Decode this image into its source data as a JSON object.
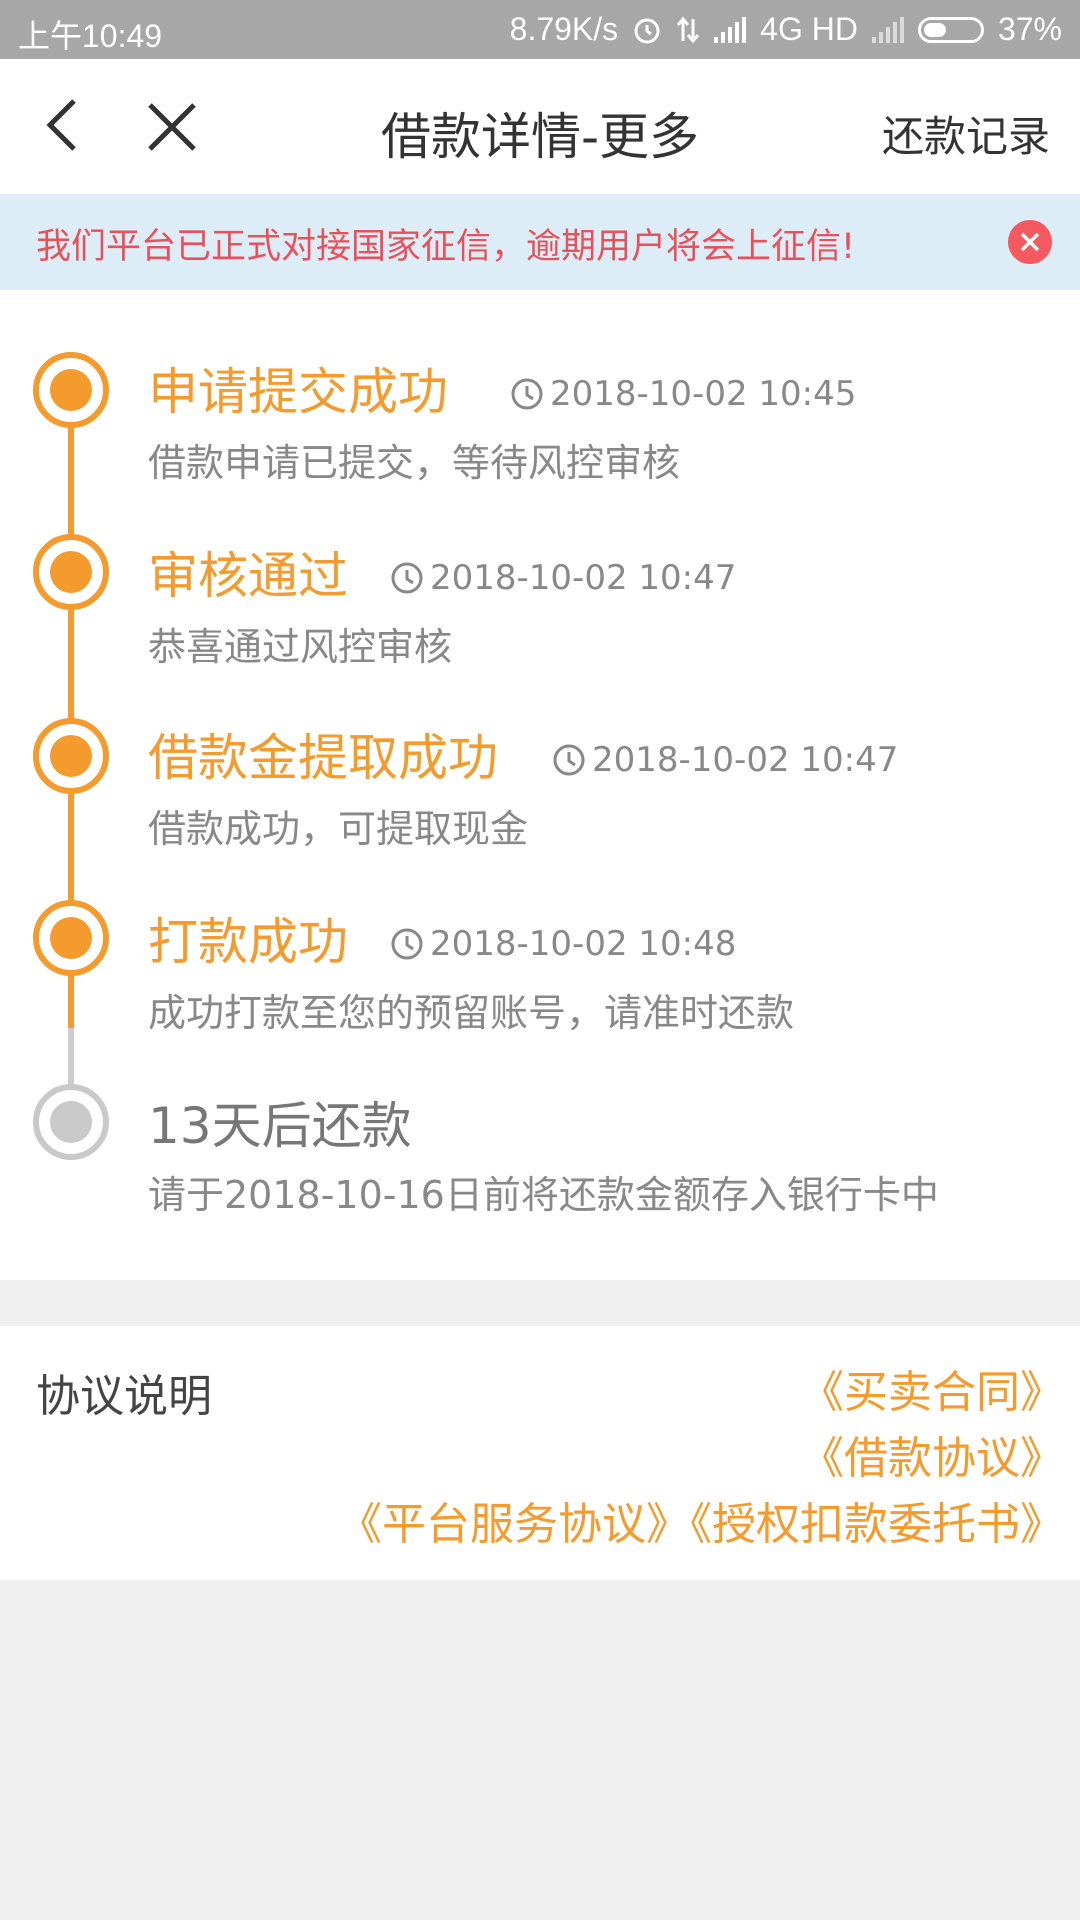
{
  "status_bar": {
    "time": "上午10:49",
    "net_speed": "8.79K/s",
    "network": "4G HD",
    "battery": "37%"
  },
  "header": {
    "title": "借款详情-更多",
    "right_link": "还款记录"
  },
  "notice": {
    "text": "我们平台已正式对接国家征信，逾期用户将会上征信!"
  },
  "timeline": [
    {
      "title": "申请提交成功",
      "time": "2018-10-02 10:45",
      "desc": "借款申请已提交，等待风控审核",
      "state": "done"
    },
    {
      "title": "审核通过",
      "time": "2018-10-02 10:47",
      "desc": "恭喜通过风控审核",
      "state": "done"
    },
    {
      "title": "借款金提取成功",
      "time": "2018-10-02 10:47",
      "desc": "借款成功，可提取现金",
      "state": "done"
    },
    {
      "title": "打款成功",
      "time": "2018-10-02 10:48",
      "desc": "成功打款至您的预留账号，请准时还款",
      "state": "done"
    },
    {
      "title": "13天后还款",
      "time": "",
      "desc": "请于2018-10-16日前将还款金额存入银行卡中",
      "state": "pending"
    }
  ],
  "agreement": {
    "label": "协议说明",
    "links": [
      "《买卖合同》",
      "《借款协议》",
      "《平台服务协议》《授权扣款委托书》"
    ]
  },
  "colors": {
    "accent": "#f59b2d",
    "notice_bg": "#dcedf7",
    "notice_text": "#e8515a",
    "pending": "#c9c9c9"
  }
}
